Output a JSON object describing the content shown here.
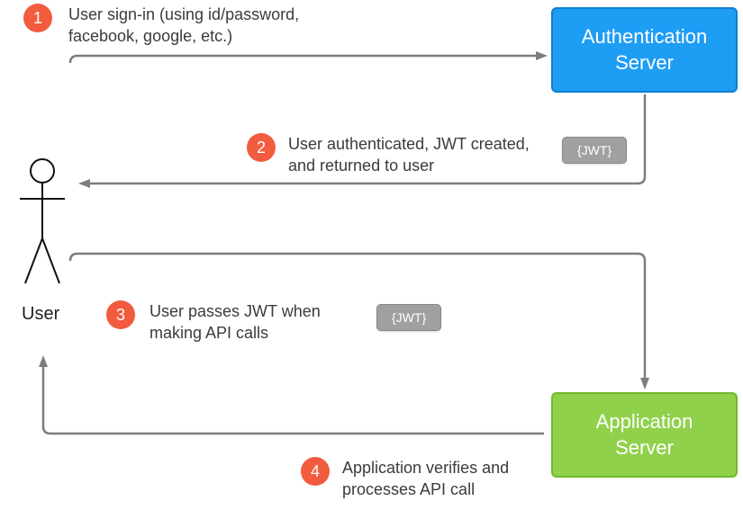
{
  "user_label": "User",
  "auth_server": {
    "line1": "Authentication",
    "line2": "Server"
  },
  "app_server": {
    "line1": "Application",
    "line2": "Server"
  },
  "jwt_label": "{JWT}",
  "steps": {
    "1": {
      "num": "1",
      "text": "User sign-in (using id/password, facebook, google, etc.)"
    },
    "2": {
      "num": "2",
      "text": "User authenticated, JWT created, and returned to user"
    },
    "3": {
      "num": "3",
      "text": "User passes JWT when making API calls"
    },
    "4": {
      "num": "4",
      "text": "Application verifies and processes API call"
    }
  },
  "colors": {
    "badge": "#f25c3e",
    "auth_bg": "#1e9df4",
    "app_bg": "#8fd14b",
    "arrow": "#7d7d7d",
    "jwt_bg": "#a0a0a0"
  }
}
